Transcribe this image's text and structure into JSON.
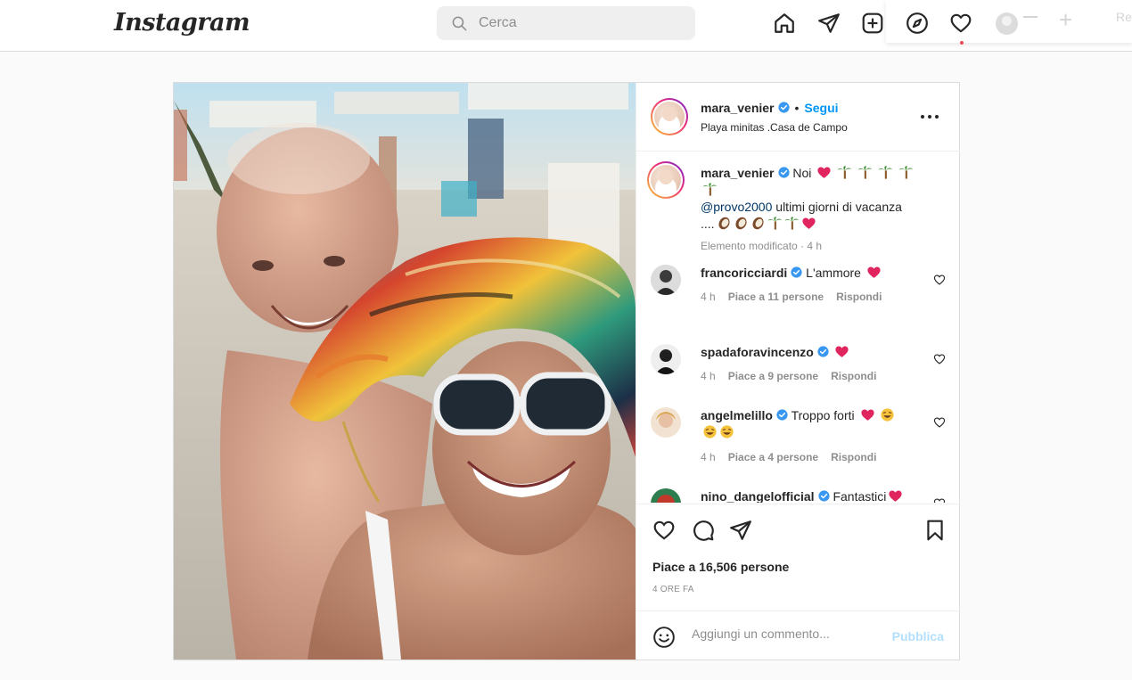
{
  "nav": {
    "logo": "Instagram",
    "search_placeholder": "Cerca",
    "icons": [
      "home-icon",
      "direct-icon",
      "new-post-icon",
      "explore-icon",
      "activity-icon"
    ],
    "ghost_text": "Re"
  },
  "post": {
    "author": "mara_venier",
    "follow_label": "Segui",
    "separator": "•",
    "location": "Playa minitas .Casa de Campo",
    "caption": {
      "username": "mara_venier",
      "text_start": "Noi",
      "mention": "@provo2000",
      "text_mid": "ultimi giorni di vacanza",
      "text_end": "....",
      "meta": "Elemento modificato · 4 h"
    },
    "comments": [
      {
        "username": "francoricciardi",
        "text": "L'ammore",
        "time": "4 h",
        "likes": "Piace a 11 persone",
        "reply": "Rispondi"
      },
      {
        "username": "spadaforavincenzo",
        "text": "",
        "time": "4 h",
        "likes": "Piace a 9 persone",
        "reply": "Rispondi"
      },
      {
        "username": "angelmelillo",
        "text": "Troppo forti",
        "time": "4 h",
        "likes": "Piace a 4 persone",
        "reply": "Rispondi"
      },
      {
        "username": "nino_dangelofficial",
        "text": "Fantastici"
      }
    ],
    "likes_text": "Piace a 16,506 persone",
    "time_ago": "4 ORE FA",
    "add_comment_placeholder": "Aggiungi un commento...",
    "publish_label": "Pubblica"
  },
  "colors": {
    "accent": "#0095f6",
    "publish_disabled": "#b2dffc",
    "heart": "#ed4956",
    "verified": "#3897f0"
  }
}
